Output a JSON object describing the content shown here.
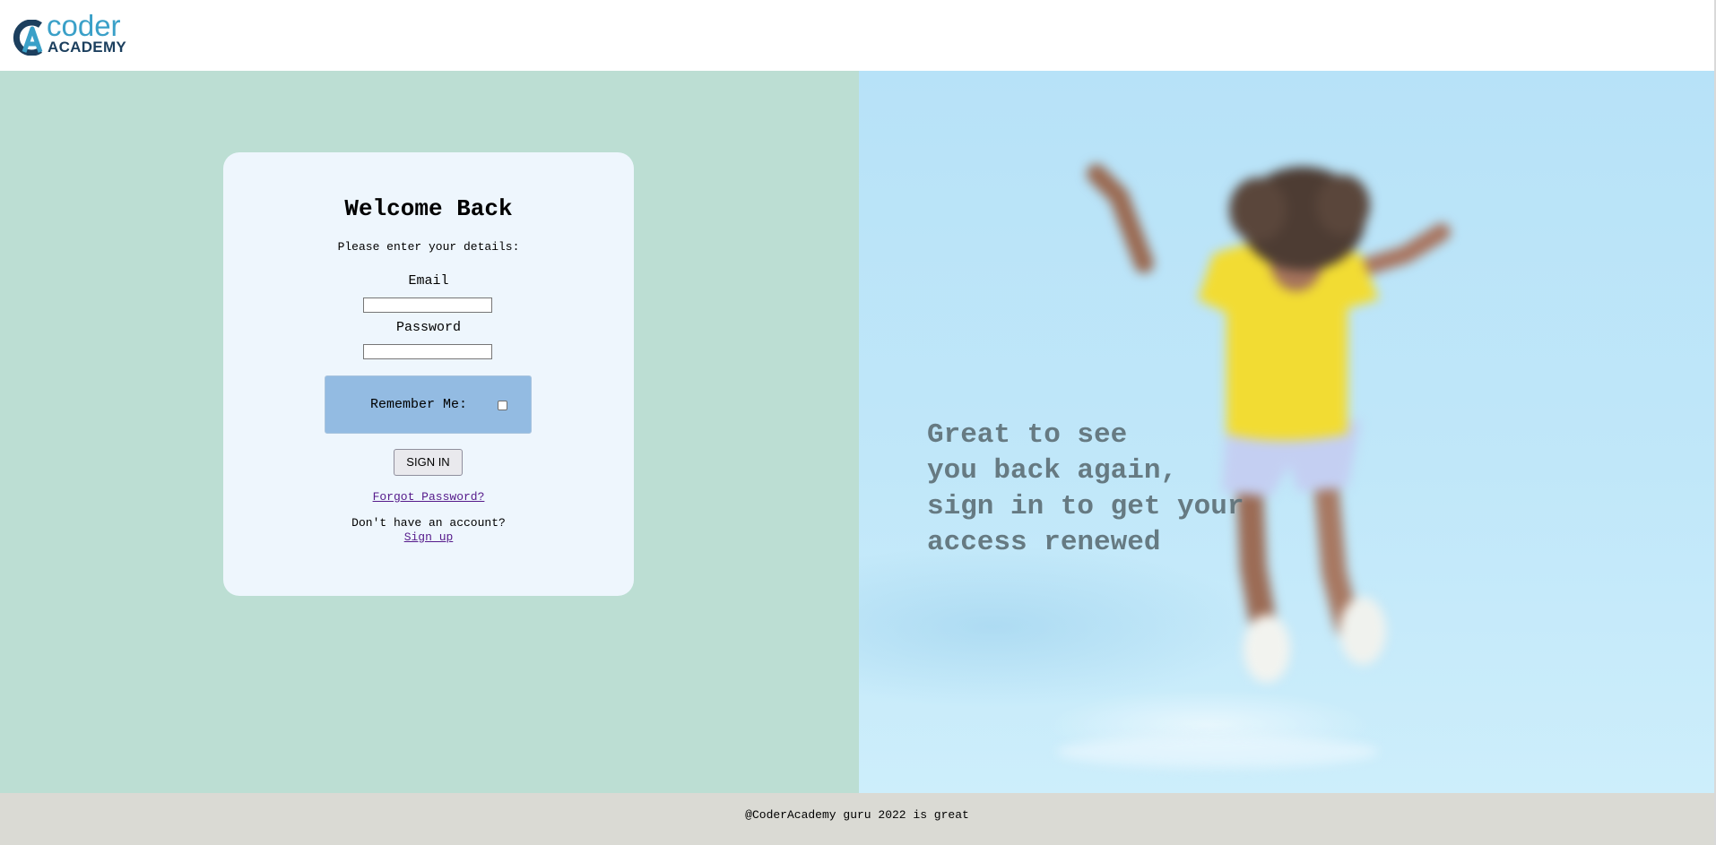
{
  "header": {
    "logo_word_top": "coder",
    "logo_word_bottom": "ACADEMY"
  },
  "login": {
    "title": "Welcome Back",
    "subtitle": "Please enter your details:",
    "email_label": "Email",
    "email_value": "",
    "password_label": "Password",
    "password_value": "",
    "remember_label": "Remember Me:",
    "remember_checked": false,
    "signin_label": "SIGN IN",
    "forgot_label": "Forgot Password?",
    "no_account_text": "Don't have an account?",
    "signup_label": "Sign up"
  },
  "hero": {
    "tagline_lines": [
      "Great to see",
      "you back again,",
      "sign in to get your",
      "access renewed"
    ]
  },
  "footer": {
    "text": "@CoderAcademy guru 2022 is great"
  },
  "colors": {
    "left_background": "#bcded3",
    "card_background": "#eef6fd",
    "remember_box": "#93bbe2",
    "footer_background": "#dadad4",
    "link": "#551a8b",
    "logo_blue": "#3aa0c8",
    "logo_navy": "#1c3f5e"
  }
}
